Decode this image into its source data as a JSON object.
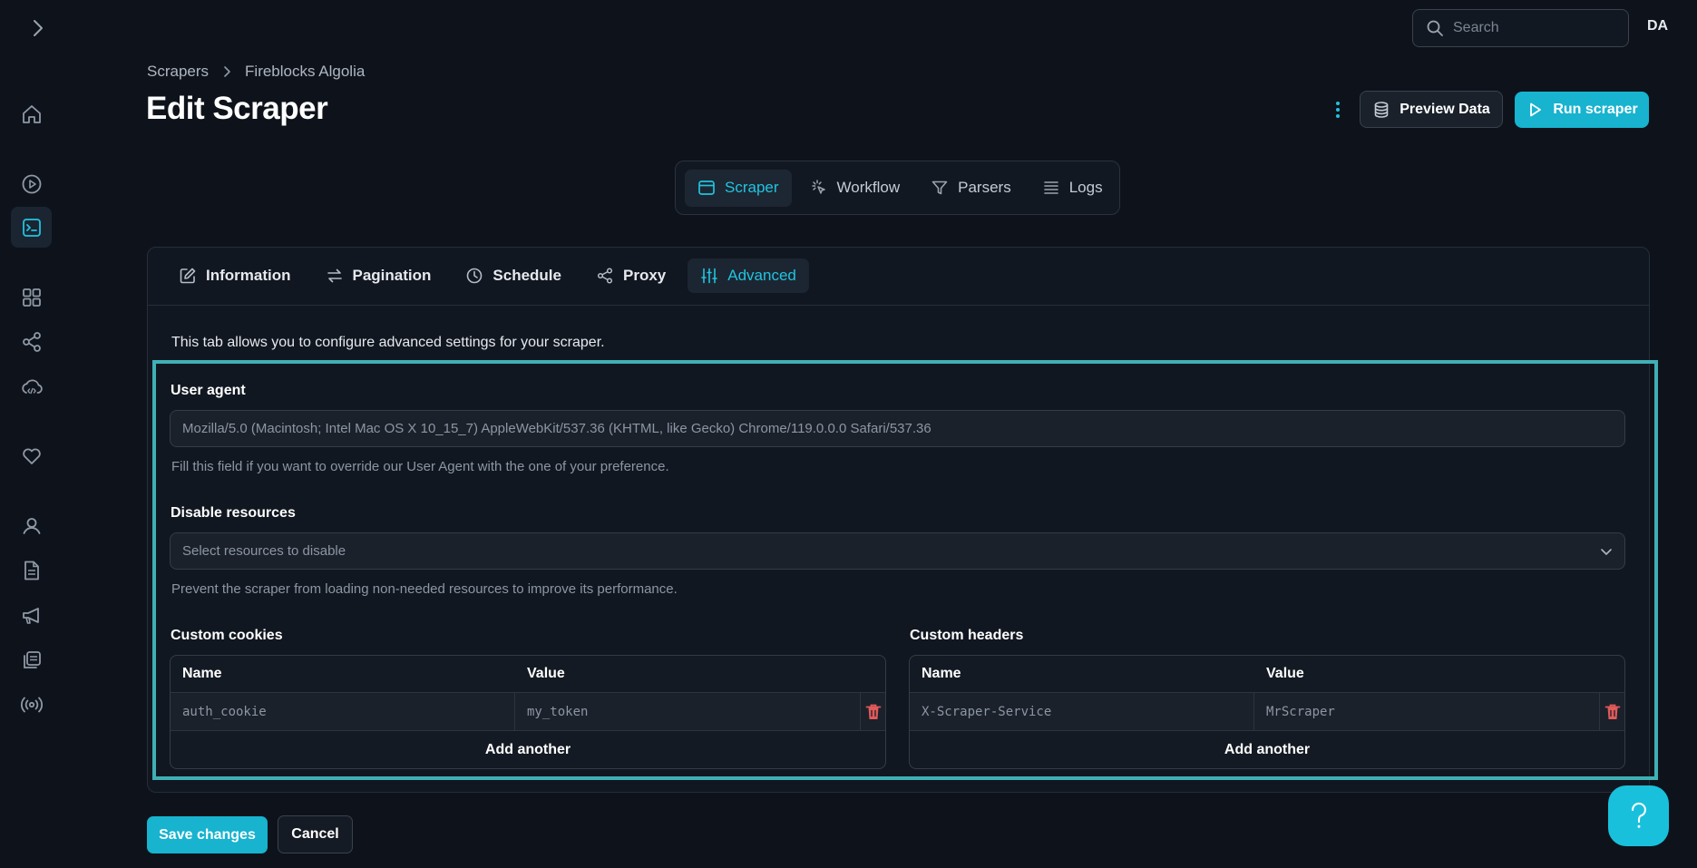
{
  "topbar": {
    "search_placeholder": "Search",
    "avatar_initials": "DA"
  },
  "breadcrumb": [
    "Scrapers",
    "Fireblocks Algolia"
  ],
  "page_title": "Edit Scraper",
  "header_actions": {
    "preview_label": "Preview Data",
    "run_label": "Run scraper"
  },
  "main_tabs": [
    {
      "label": "Scraper",
      "icon": "browser-window-icon",
      "active": true
    },
    {
      "label": "Workflow",
      "icon": "pointer-click-icon",
      "active": false
    },
    {
      "label": "Parsers",
      "icon": "filter-icon",
      "active": false
    },
    {
      "label": "Logs",
      "icon": "list-icon",
      "active": false
    }
  ],
  "sub_tabs": [
    {
      "label": "Information",
      "icon": "edit-icon",
      "active": false
    },
    {
      "label": "Pagination",
      "icon": "arrows-swap-icon",
      "active": false
    },
    {
      "label": "Schedule",
      "icon": "clock-icon",
      "active": false
    },
    {
      "label": "Proxy",
      "icon": "share-nodes-icon",
      "active": false
    },
    {
      "label": "Advanced",
      "icon": "sliders-icon",
      "active": true
    }
  ],
  "advanced": {
    "intro": "This tab allows you to configure advanced settings for your scraper.",
    "user_agent": {
      "label": "User agent",
      "placeholder": "Mozilla/5.0 (Macintosh; Intel Mac OS X 10_15_7) AppleWebKit/537.36 (KHTML, like Gecko) Chrome/119.0.0.0 Safari/537.36",
      "help": "Fill this field if you want to override our User Agent with the one of your preference."
    },
    "disable_resources": {
      "label": "Disable resources",
      "placeholder": "Select resources to disable",
      "help": "Prevent the scraper from loading non-needed resources to improve its performance."
    },
    "custom_cookies": {
      "label": "Custom cookies",
      "col_name": "Name",
      "col_value": "Value",
      "rows": [
        {
          "name": "auth_cookie",
          "value": "my_token"
        }
      ],
      "add_label": "Add another"
    },
    "custom_headers": {
      "label": "Custom headers",
      "col_name": "Name",
      "col_value": "Value",
      "rows": [
        {
          "name": "X-Scraper-Service",
          "value": "MrScraper"
        }
      ],
      "add_label": "Add another"
    }
  },
  "footer": {
    "save_label": "Save changes",
    "cancel_label": "Cancel"
  },
  "colors": {
    "accent": "#17b3cf",
    "background": "#0e131b",
    "highlight_border": "#3fb0b6",
    "delete": "#e05a5a"
  }
}
